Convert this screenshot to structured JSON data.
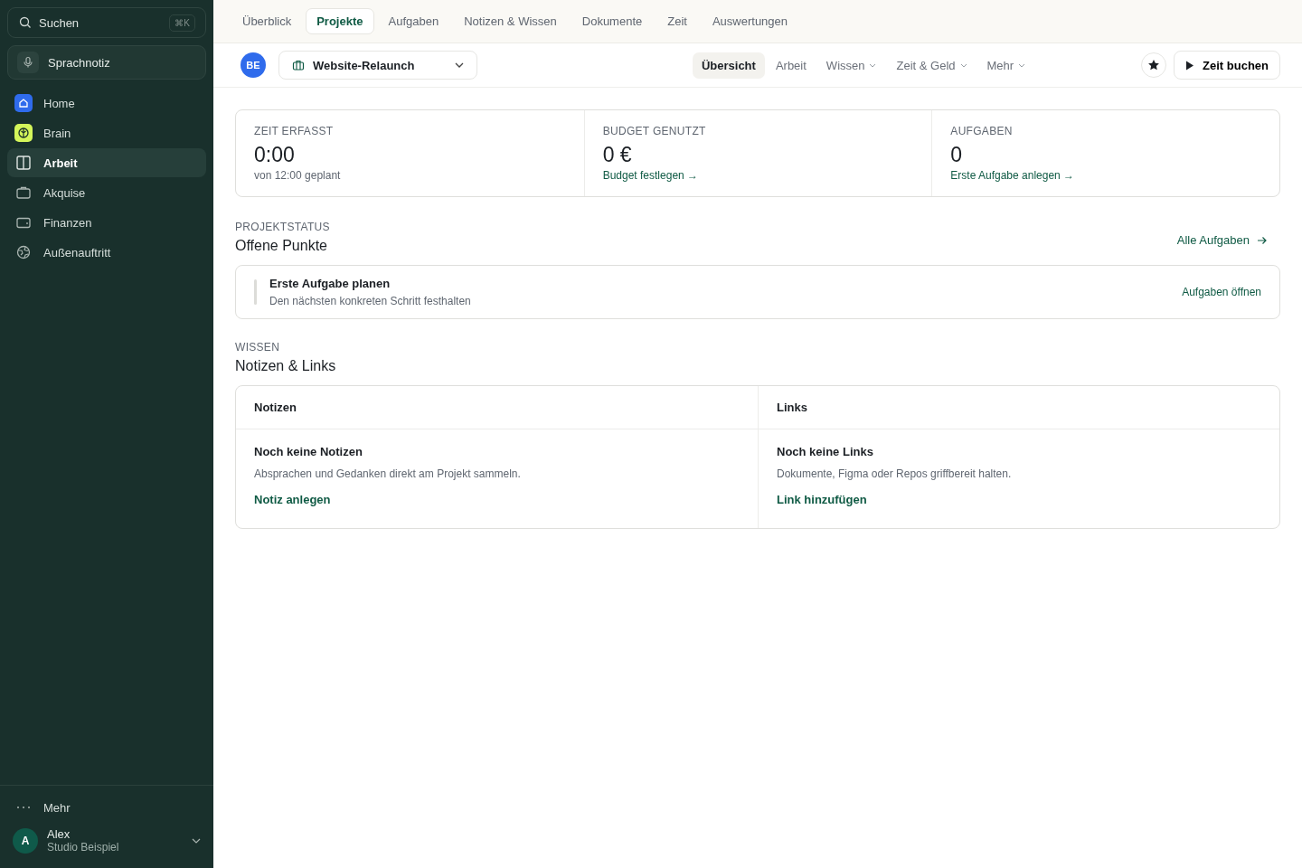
{
  "sidebar": {
    "search": {
      "placeholder": "Suchen",
      "shortcut": "⌘K"
    },
    "voice_button": "Sprachnotiz",
    "items": [
      {
        "label": "Home",
        "kind": "home",
        "selected": false
      },
      {
        "label": "Brain",
        "kind": "brain",
        "selected": false
      },
      {
        "label": "Arbeit",
        "kind": "columns",
        "selected": true
      },
      {
        "label": "Akquise",
        "kind": "briefcase",
        "selected": false
      },
      {
        "label": "Finanzen",
        "kind": "wallet",
        "selected": false
      },
      {
        "label": "Außenauftritt",
        "kind": "globe",
        "selected": false
      }
    ],
    "more": "Mehr",
    "user": {
      "initial": "A",
      "name": "Alex",
      "org": "Studio Beispiel"
    }
  },
  "tabs": [
    {
      "label": "Überblick",
      "selected": false
    },
    {
      "label": "Projekte",
      "selected": true
    },
    {
      "label": "Aufgaben",
      "selected": false
    },
    {
      "label": "Notizen & Wissen",
      "selected": false
    },
    {
      "label": "Dokumente",
      "selected": false
    },
    {
      "label": "Zeit",
      "selected": false
    },
    {
      "label": "Auswertungen",
      "selected": false
    }
  ],
  "project": {
    "badge": "BE",
    "name": "Website-Relaunch"
  },
  "subnav": [
    {
      "label": "Übersicht",
      "selected": true,
      "dropdown": false
    },
    {
      "label": "Arbeit",
      "selected": false,
      "dropdown": false
    },
    {
      "label": "Wissen",
      "selected": false,
      "dropdown": true
    },
    {
      "label": "Zeit & Geld",
      "selected": false,
      "dropdown": true
    },
    {
      "label": "Mehr",
      "selected": false,
      "dropdown": true
    }
  ],
  "book_button": "Zeit buchen",
  "stats": [
    {
      "label": "ZEIT ERFASST",
      "value": "0:00",
      "kind": "note",
      "detail": "von 12:00 geplant"
    },
    {
      "label": "BUDGET GENUTZT",
      "value": "0 €",
      "kind": "link",
      "detail": "Budget festlegen →"
    },
    {
      "label": "AUFGABEN",
      "value": "0",
      "kind": "link",
      "detail": "Erste Aufgabe anlegen →"
    }
  ],
  "status": {
    "eyebrow": "PROJEKTSTATUS",
    "title": "Offene Punkte",
    "link": "Alle Aufgaben",
    "item": {
      "title": "Erste Aufgabe planen",
      "description": "Den nächsten konkreten Schritt festhalten",
      "action": "Aufgaben öffnen"
    }
  },
  "knowledge": {
    "eyebrow": "WISSEN",
    "title": "Notizen & Links",
    "columns": [
      {
        "heading": "Notizen",
        "empty_title": "Noch keine Notizen",
        "empty_text": "Absprachen und Gedanken direkt am Projekt sammeln.",
        "action": "Notiz anlegen"
      },
      {
        "heading": "Links",
        "empty_title": "Noch keine Links",
        "empty_text": "Dokumente, Figma oder Repos griffbereit halten.",
        "action": "Link hinzufügen"
      }
    ]
  }
}
